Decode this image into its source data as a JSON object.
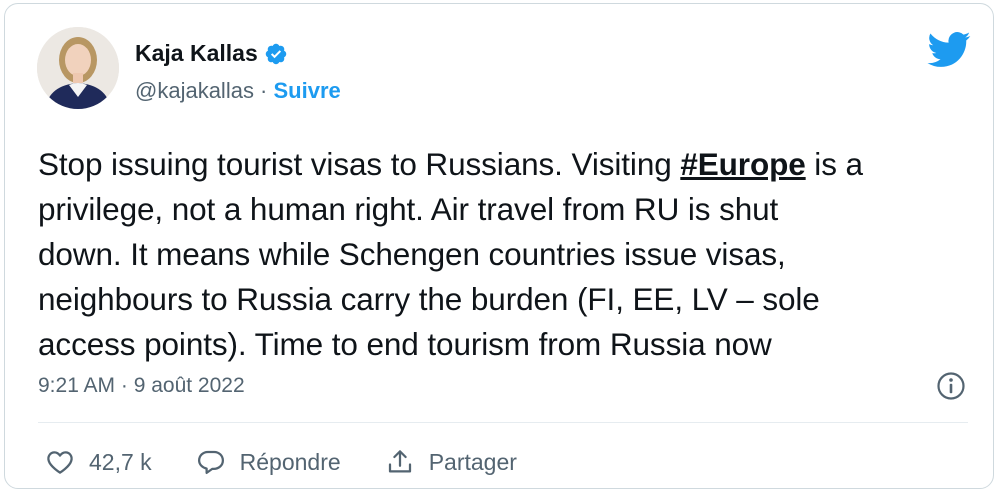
{
  "author": {
    "name": "Kaja Kallas",
    "handle": "@kajakallas",
    "separator": " · ",
    "follow_label": "Suivre",
    "verified_icon": "verified-badge-icon",
    "avatar_icon": "profile-avatar"
  },
  "tweet": {
    "lines": [
      {
        "before": "Stop issuing tourist visas to Russians. Visiting ",
        "hashtag": "#Europe",
        "after": " is a"
      },
      {
        "text": "privilege, not a human right. Air travel from RU is shut"
      },
      {
        "text": "down. It means while Schengen countries issue visas,"
      },
      {
        "text": "neighbours to Russia carry the burden (FI, EE, LV – sole"
      },
      {
        "text": "access points). Time to end tourism from Russia now"
      }
    ],
    "timestamp": "9:21 AM · 9 août 2022"
  },
  "actions": {
    "like_count": "42,7 k",
    "reply_label": "Répondre",
    "share_label": "Partager"
  },
  "colors": {
    "accent": "#1d9bf0",
    "text": "#0f1419",
    "muted": "#536471",
    "border": "#cfd9de"
  }
}
